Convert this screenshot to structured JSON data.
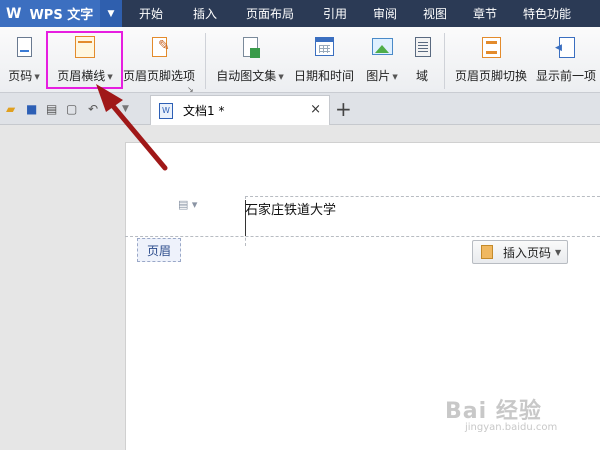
{
  "app": {
    "name": "WPS 文字",
    "logo_glyph": "W"
  },
  "menu": {
    "items": [
      "开始",
      "插入",
      "页面布局",
      "引用",
      "审阅",
      "视图",
      "章节",
      "特色功能"
    ]
  },
  "ribbon": {
    "page_number": "页码",
    "header_line": "页眉横线",
    "header_footer_options": "页眉页脚选项",
    "auto_text": "自动图文集",
    "date_time": "日期和时间",
    "picture": "图片",
    "field": "域",
    "header_footer_switch": "页眉页脚切换",
    "show_previous": "显示前一项"
  },
  "tabs": {
    "document_title": "文档1 *",
    "close_glyph": "×",
    "add_glyph": "+"
  },
  "document": {
    "header_text": "石家庄铁道大学",
    "header_label": "页眉",
    "insert_page_number": "插入页码"
  },
  "watermark": {
    "main": "Bai 经验",
    "sub": "jingyan.baidu.com"
  },
  "colors": {
    "accent_highlight": "#e61ee0",
    "arrow": "#a01818",
    "menubar": "#2b3a55"
  }
}
